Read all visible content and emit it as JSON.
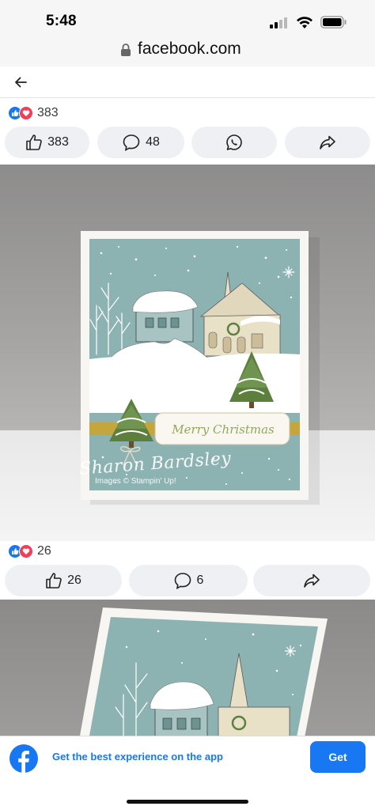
{
  "status_bar": {
    "time": "5:48"
  },
  "browser": {
    "url": "facebook.com"
  },
  "posts": [
    {
      "reactions_count": "383",
      "actions": {
        "like_count": "383",
        "comment_count": "48"
      },
      "image": {
        "card_text": "Merry Christmas",
        "watermark_name": "Sharon Bardsley",
        "watermark_sub": "Images © Stampin' Up!"
      }
    },
    {
      "reactions_count": "26",
      "actions": {
        "like_count": "26",
        "comment_count": "6"
      }
    }
  ],
  "app_banner": {
    "message": "Get the best experience on the app",
    "button_label": "Get"
  },
  "colors": {
    "facebook_blue": "#1877f2",
    "love_red": "#f33e58",
    "card_teal": "#8db2b2",
    "card_mustard": "#c4a63c"
  },
  "icons": [
    "lock-icon",
    "back-arrow-icon",
    "like-icon",
    "comment-icon",
    "whatsapp-icon",
    "share-icon",
    "facebook-logo-icon"
  ]
}
